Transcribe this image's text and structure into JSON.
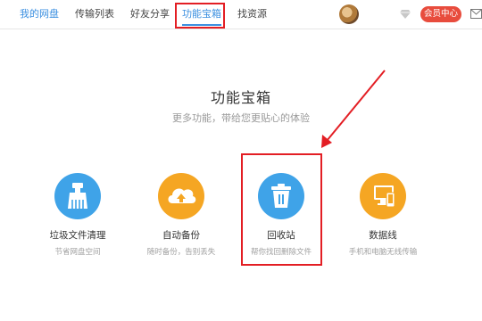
{
  "nav": {
    "items": [
      {
        "label": "我的网盘"
      },
      {
        "label": "传输列表"
      },
      {
        "label": "好友分享"
      },
      {
        "label": "功能宝箱"
      },
      {
        "label": "找资源"
      }
    ],
    "active_index": 3,
    "vip_label": "会员中心",
    "icons": [
      "avatar",
      "diamond-icon",
      "mail-icon"
    ]
  },
  "main": {
    "title": "功能宝箱",
    "subtitle": "更多功能，带给您更贴心的体验"
  },
  "tools": [
    {
      "name": "垃圾文件清理",
      "desc": "节省网盘空间",
      "icon": "broom-icon",
      "color": "#3fa3e8"
    },
    {
      "name": "自动备份",
      "desc": "随时备份，告别丢失",
      "icon": "cloud-upload-icon",
      "color": "#f5a623"
    },
    {
      "name": "回收站",
      "desc": "帮你找回删除文件",
      "icon": "trash-icon",
      "color": "#3fa3e8"
    },
    {
      "name": "数据线",
      "desc": "手机和电脑无线传输",
      "icon": "devices-icon",
      "color": "#f5a623"
    }
  ],
  "colors": {
    "accent": "#3b8fe0",
    "annotation_red": "#e31e24",
    "vip_red": "#e84c3d",
    "blue_icon": "#3fa3e8",
    "orange_icon": "#f5a623"
  }
}
